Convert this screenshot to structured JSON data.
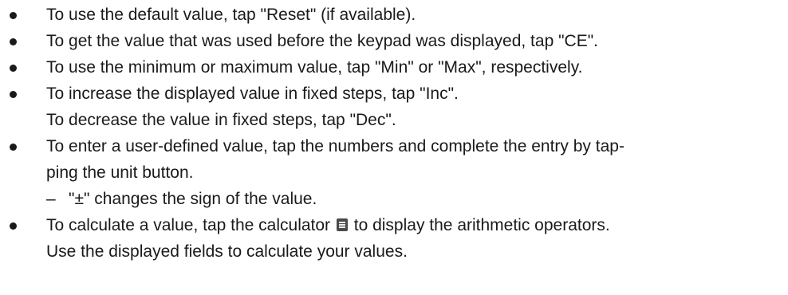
{
  "items": [
    {
      "lines": [
        "To use the default value, tap \"Reset\" (if available)."
      ]
    },
    {
      "lines": [
        "To get the value that was used before the keypad was displayed, tap \"CE\"."
      ]
    },
    {
      "lines": [
        "To use the minimum or maximum value, tap \"Min\" or \"Max\", respectively."
      ]
    },
    {
      "lines": [
        "To increase the displayed value in fixed steps, tap \"Inc\".",
        "To decrease the value in fixed steps, tap \"Dec\"."
      ]
    },
    {
      "lines": [
        "To enter a user-defined value, tap the numbers and complete the entry by tap-",
        "ping the unit button."
      ],
      "sub": {
        "dash": "–",
        "text": "\"±\" changes the sign of the value."
      }
    },
    {
      "line1_before": "To calculate a value, tap the calculator",
      "line1_after": "to display the arithmetic operators.",
      "line2": "Use the displayed fields to calculate your values.",
      "icon": "calculator-icon"
    }
  ]
}
